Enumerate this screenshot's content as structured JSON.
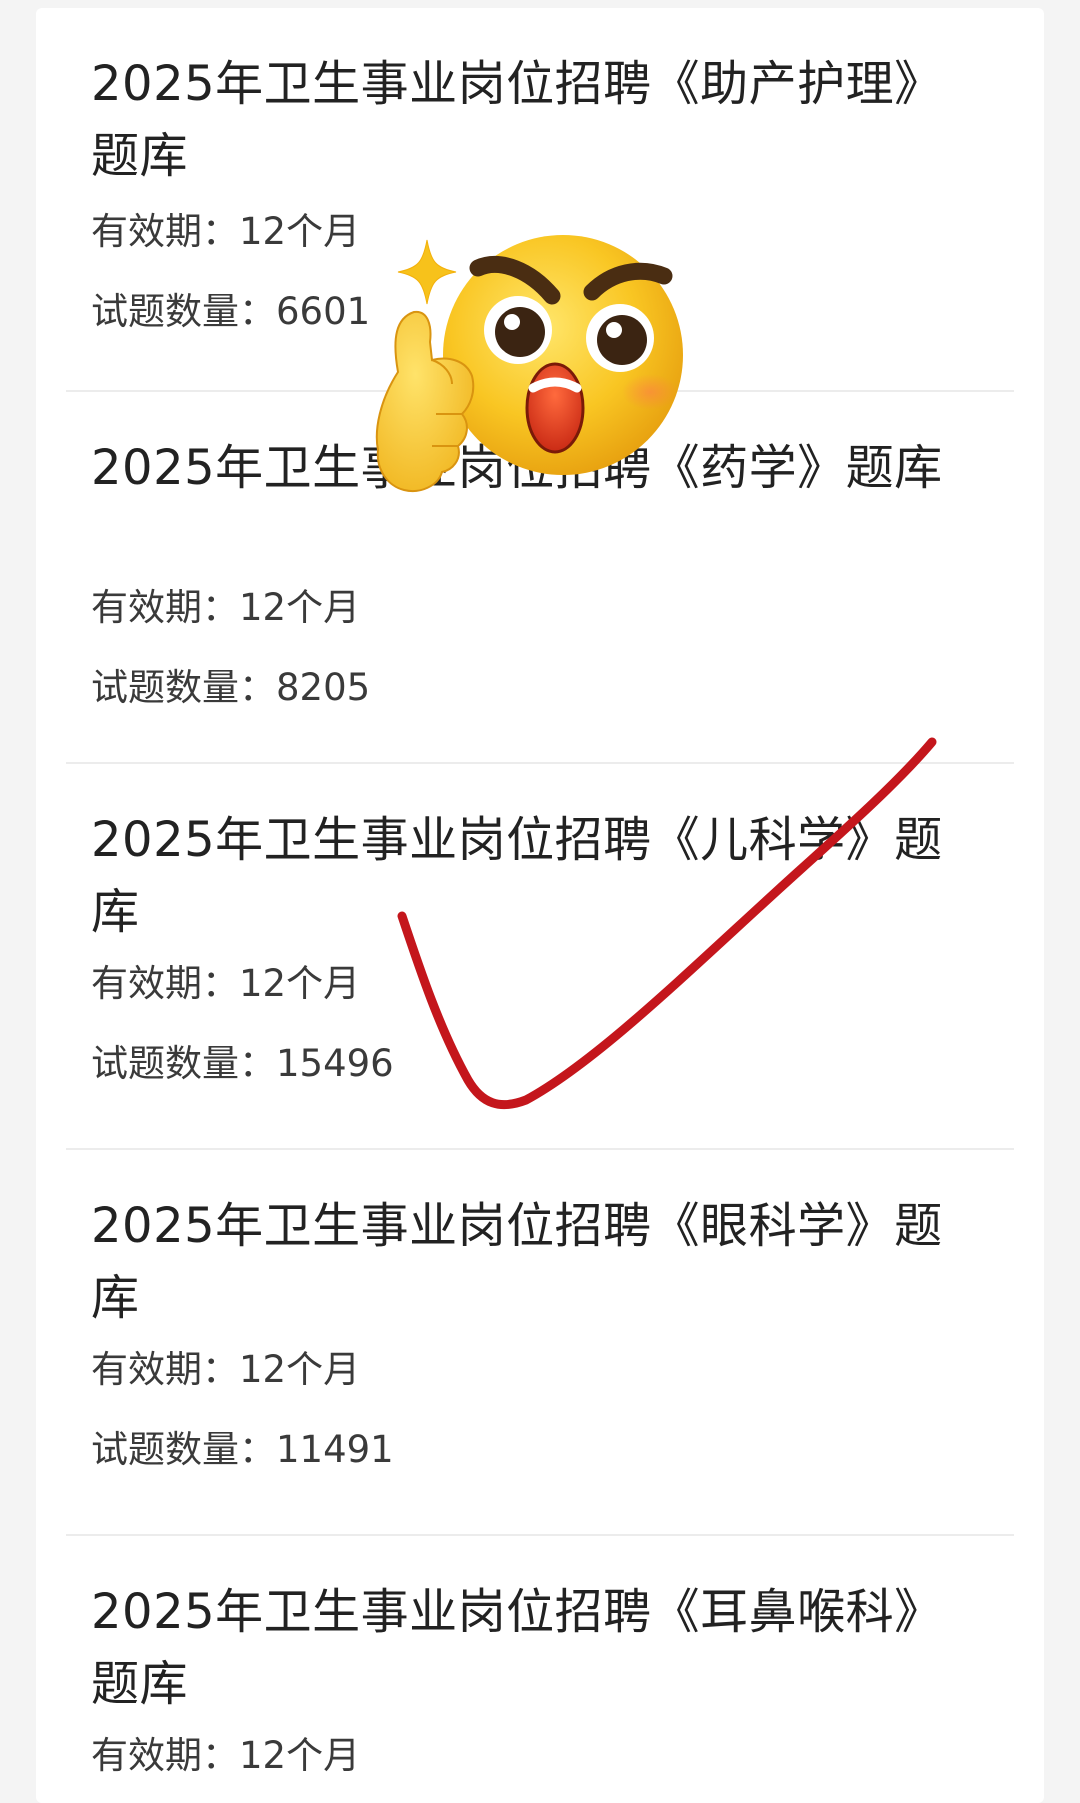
{
  "items": [
    {
      "title": "2025年卫生事业岗位招聘《助产护理》题库",
      "validity": "有效期：12个月",
      "count": "试题数量：6601"
    },
    {
      "title": "2025年卫生事业岗位招聘《药学》题库",
      "validity": "有效期：12个月",
      "count": "试题数量：8205"
    },
    {
      "title": "2025年卫生事业岗位招聘《儿科学》题库",
      "validity": "有效期：12个月",
      "count": "试题数量：15496"
    },
    {
      "title": "2025年卫生事业岗位招聘《眼科学》题库",
      "validity": "有效期：12个月",
      "count": "试题数量：11491"
    },
    {
      "title": "2025年卫生事业岗位招聘《耳鼻喉科》题库",
      "validity": "有效期：12个月"
    }
  ],
  "colors": {
    "checkmark": "#c4161c",
    "emoji_face": "#f7c21b",
    "sparkle": "#f7c21b"
  },
  "icons": {
    "emoji": "thinking-thumbs-up-emoji-icon",
    "sparkle": "sparkle-icon",
    "check": "red-checkmark-icon"
  }
}
